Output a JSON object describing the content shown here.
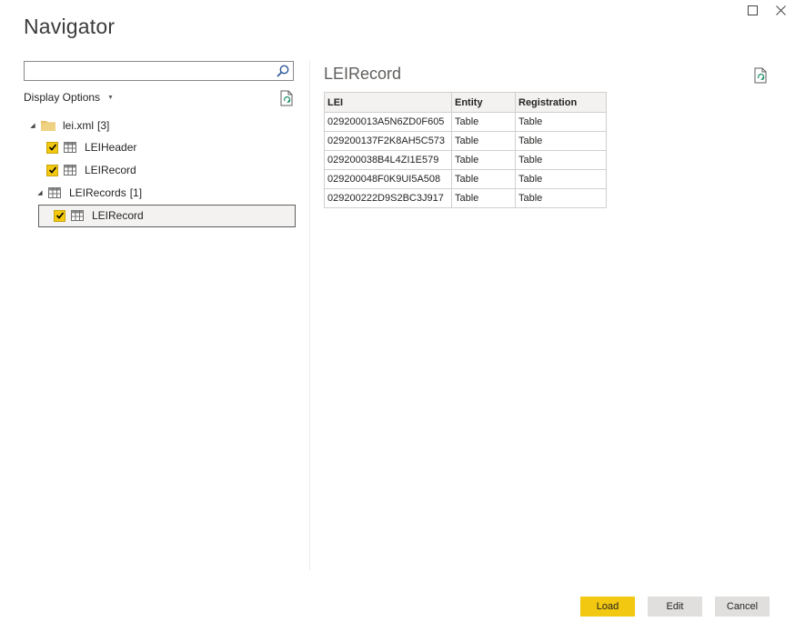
{
  "window": {
    "title": "Navigator"
  },
  "left_pane": {
    "search": {
      "value": "",
      "placeholder": ""
    },
    "display_options_label": "Display Options",
    "tree": {
      "root": {
        "label": "lei.xml",
        "count": "[3]"
      },
      "items": [
        {
          "label": "LEIHeader",
          "checked": true
        },
        {
          "label": "LEIRecord",
          "checked": true
        }
      ],
      "group": {
        "label": "LEIRecords",
        "count": "[1]"
      },
      "group_items": [
        {
          "label": "LEIRecord",
          "checked": true,
          "selected": true
        }
      ]
    }
  },
  "preview": {
    "title": "LEIRecord",
    "columns": [
      "LEI",
      "Entity",
      "Registration"
    ],
    "rows": [
      [
        "029200013A5N6ZD0F605",
        "Table",
        "Table"
      ],
      [
        "029200137F2K8AH5C573",
        "Table",
        "Table"
      ],
      [
        "029200038B4L4ZI1E579",
        "Table",
        "Table"
      ],
      [
        "029200048F0K9UI5A508",
        "Table",
        "Table"
      ],
      [
        "029200222D9S2BC3J917",
        "Table",
        "Table"
      ]
    ]
  },
  "buttons": {
    "load": "Load",
    "edit": "Edit",
    "cancel": "Cancel"
  },
  "colors": {
    "accent": "#f2c811",
    "button_secondary": "#e1dfdd",
    "border": "#d2d0ce"
  },
  "icons": {
    "search": "search-icon",
    "refresh": "refresh-icon",
    "folder": "folder-icon",
    "table": "table-icon",
    "checkbox": "checkmark-icon",
    "maximize": "maximize-icon",
    "close": "close-icon"
  }
}
